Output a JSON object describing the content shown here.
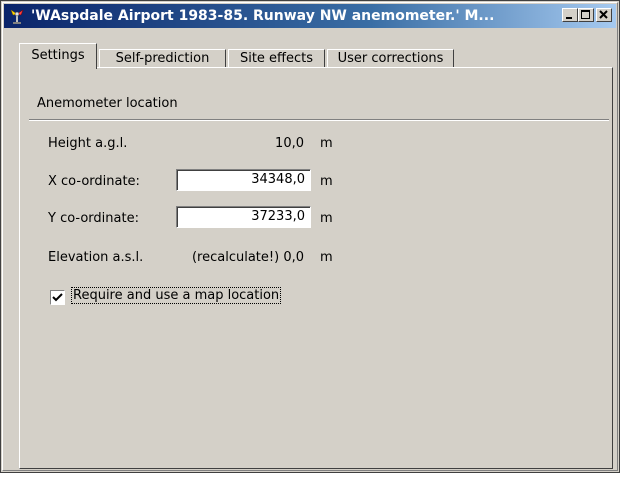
{
  "window": {
    "title": "'WAspdale Airport 1983-85. Runway NW anemometer.' M...",
    "buttons": {
      "minimize": "minimize-icon",
      "maximize": "maximize-icon",
      "close": "close-icon"
    }
  },
  "tabs": [
    {
      "label": "Settings",
      "active": true
    },
    {
      "label": "Self-prediction",
      "active": false
    },
    {
      "label": "Site effects",
      "active": false
    },
    {
      "label": "User corrections",
      "active": false
    }
  ],
  "group": {
    "title": "Anemometer location"
  },
  "fields": {
    "height": {
      "label": "Height a.g.l.",
      "value": "10,0",
      "unit": "m"
    },
    "x": {
      "label": "X co-ordinate:",
      "value": "34348,0",
      "unit": "m"
    },
    "y": {
      "label": "Y co-ordinate:",
      "value": "37233,0",
      "unit": "m"
    },
    "elevation": {
      "label": "Elevation a.s.l.",
      "value": "(recalculate!) 0,0",
      "unit": "m"
    }
  },
  "map_location": {
    "label": "Require and use a map location",
    "checked": true
  },
  "colors": {
    "titlebar_start": "#0a246a",
    "titlebar_end": "#a6caf0",
    "face": "#d4d0c8"
  }
}
